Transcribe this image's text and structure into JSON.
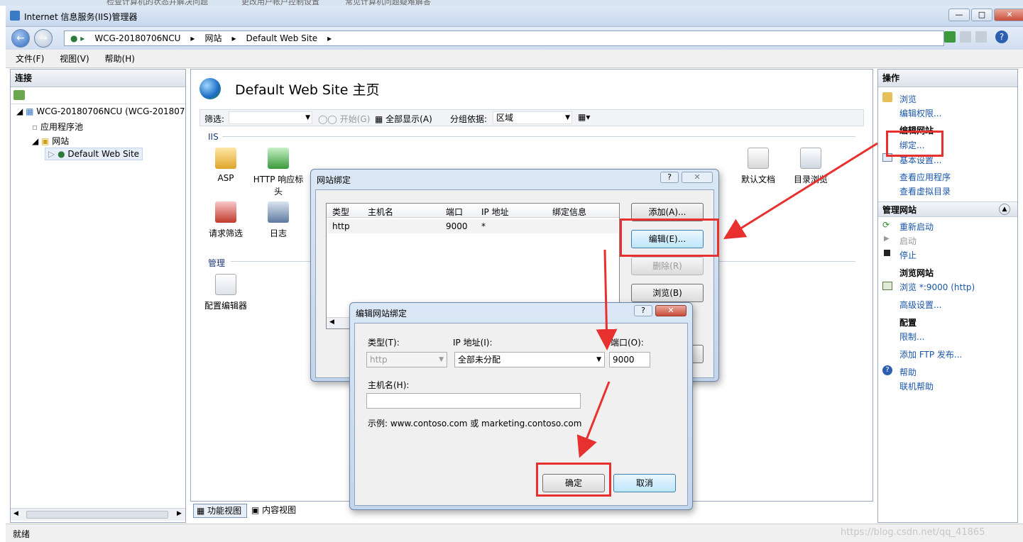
{
  "window": {
    "title": "Internet 信息服务(IIS)管理器",
    "bg_tabs": [
      "检查计算机的状态并解决问题",
      "更改用户帐户控制设置",
      "常见计算机问题疑难解答"
    ]
  },
  "address": {
    "crumbs": [
      "WCG-20180706NCU",
      "网站",
      "Default Web Site"
    ]
  },
  "menu": {
    "file": "文件(F)",
    "view": "视图(V)",
    "help": "帮助(H)"
  },
  "connections": {
    "title": "连接",
    "server": "WCG-20180706NCU (WCG-201807",
    "app_pools": "应用程序池",
    "sites": "网站",
    "site": "Default Web Site"
  },
  "page": {
    "title": "Default Web Site 主页",
    "filter_label": "筛选:",
    "start": "开始(G)",
    "show_all": "全部显示(A)",
    "group_label": "分组依据:",
    "group_value": "区域",
    "section_iis": "IIS",
    "section_mgmt": "管理"
  },
  "features": {
    "asp": "ASP",
    "http_headers": "HTTP 响应标头",
    "default_doc": "默认文档",
    "dir_browse": "目录浏览",
    "req_filter": "请求筛选",
    "logging": "日志",
    "config_editor": "配置编辑器"
  },
  "bottom_tabs": {
    "features": "功能视图",
    "content": "内容视图"
  },
  "actions": {
    "title": "操作",
    "browse": "浏览",
    "edit_perms": "编辑权限...",
    "edit_site": "编辑网站",
    "bindings": "绑定...",
    "basic": "基本设置...",
    "view_apps": "查看应用程序",
    "view_vdirs": "查看虚拟目录",
    "manage_site": "管理网站",
    "restart": "重新启动",
    "start": "启动",
    "stop": "停止",
    "browse_site": "浏览网站",
    "browse_link": "浏览 *:9000 (http)",
    "advanced": "高级设置...",
    "config": "配置",
    "limits": "限制...",
    "add_ftp": "添加 FTP 发布...",
    "help": "帮助",
    "online_help": "联机帮助"
  },
  "site_bindings": {
    "title": "网站绑定",
    "help_btn": "?",
    "columns": [
      "类型",
      "主机名",
      "端口",
      "IP 地址",
      "绑定信息"
    ],
    "rows": [
      {
        "type": "http",
        "host": "",
        "port": "9000",
        "ip": "*",
        "info": ""
      }
    ],
    "add": "添加(A)...",
    "edit": "编辑(E)...",
    "remove": "删除(R)",
    "browse": "浏览(B)"
  },
  "edit_binding": {
    "title": "编辑网站绑定",
    "type_label": "类型(T):",
    "type_value": "http",
    "ip_label": "IP 地址(I):",
    "ip_value": "全部未分配",
    "port_label": "端口(O):",
    "port_value": "9000",
    "host_label": "主机名(H):",
    "host_value": "",
    "example": "示例: www.contoso.com 或 marketing.contoso.com",
    "ok": "确定",
    "cancel": "取消"
  },
  "status": {
    "text": "就绪"
  },
  "watermark": "https://blog.csdn.net/qq_41865"
}
